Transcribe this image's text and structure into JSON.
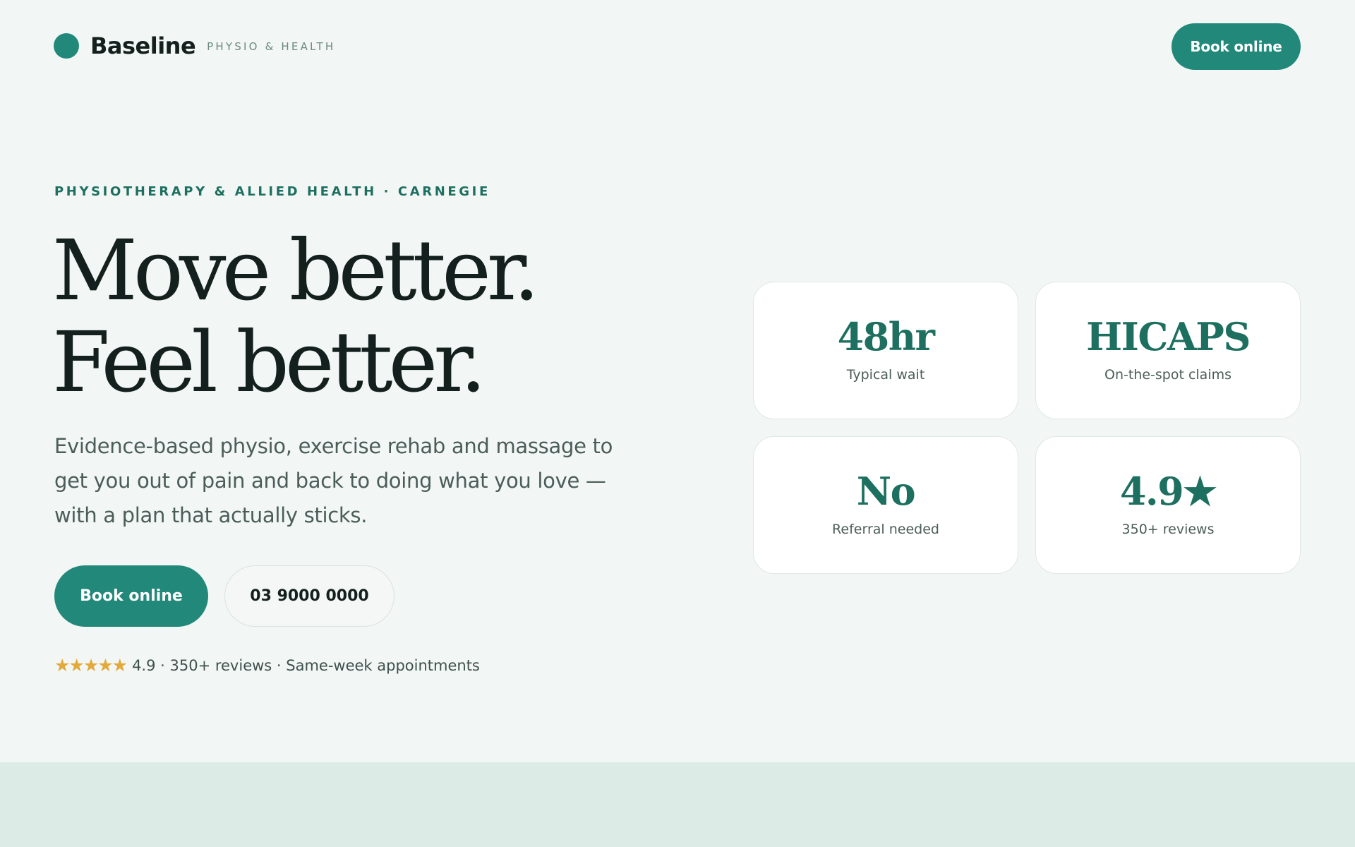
{
  "header": {
    "brand_name": "Baseline",
    "brand_tagline": "PHYSIO & HEALTH",
    "cta_label": "Book online"
  },
  "hero": {
    "eyebrow": "PHYSIOTHERAPY & ALLIED HEALTH · CARNEGIE",
    "headline_line1": "Move better.",
    "headline_line2": "Feel better.",
    "lede": "Evidence-based physio, exercise rehab and massage to get you out of pain and back to doing what you love — with a plan that actually sticks.",
    "primary_cta": "Book online",
    "phone_cta": "03 9000 0000",
    "rating_stars": "★★★★★",
    "rating_text": "4.9 · 350+ reviews · Same-week appointments"
  },
  "stats": [
    {
      "value": "48hr",
      "label": "Typical wait"
    },
    {
      "value": "HICAPS",
      "label": "On-the-spot claims"
    },
    {
      "value": "No",
      "label": "Referral needed"
    },
    {
      "value": "4.9★",
      "label": "350+ reviews"
    }
  ],
  "colors": {
    "background": "#f2f6f5",
    "accent": "#22897a",
    "accent_dark": "#1d6f5f",
    "star": "#e2a93b",
    "band": "#dcebe6"
  },
  "icons": {
    "brand_mark": "brand-dot-icon",
    "rating": "star-icon"
  }
}
